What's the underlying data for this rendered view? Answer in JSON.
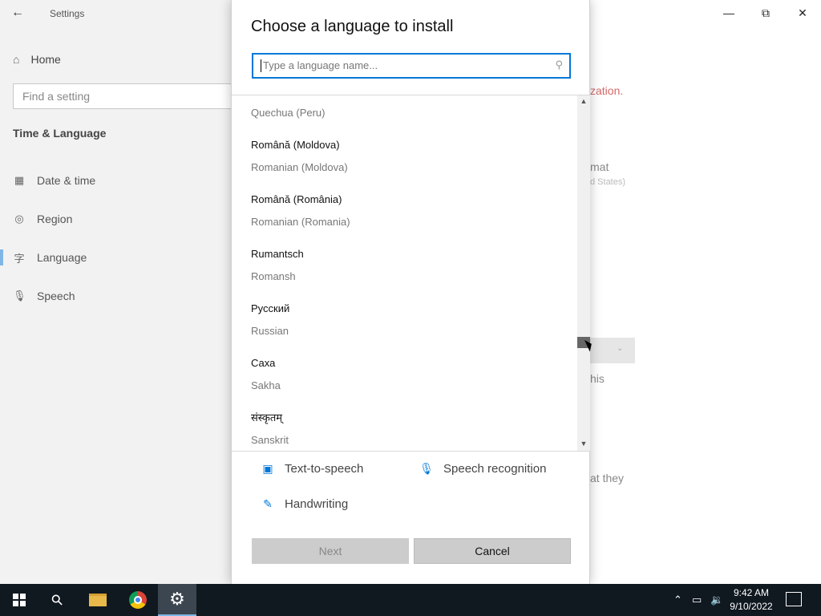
{
  "settings": {
    "title": "Settings",
    "home_label": "Home",
    "search_placeholder": "Find a setting",
    "section_title": "Time & Language",
    "nav_items": [
      {
        "label": "Date & time",
        "icon": "calendar-clock-icon"
      },
      {
        "label": "Region",
        "icon": "globe-icon"
      },
      {
        "label": "Language",
        "icon": "language-icon"
      },
      {
        "label": "Speech",
        "icon": "microphone-icon"
      }
    ],
    "active_nav": "Language",
    "partial_texts": {
      "localization": "zation.",
      "format": "mat",
      "united_states": "d States)",
      "this": "his",
      "that_they": "at they"
    },
    "window_controls": [
      "minimize",
      "restore",
      "close"
    ]
  },
  "dialog": {
    "title": "Choose a language to install",
    "search_placeholder": "Type a language name...",
    "languages": [
      {
        "native": "",
        "english": "Quechua (Peru)"
      },
      {
        "native": "Română (Moldova)",
        "english": "Romanian (Moldova)"
      },
      {
        "native": "Română (România)",
        "english": "Romanian (Romania)"
      },
      {
        "native": "Rumantsch",
        "english": "Romansh"
      },
      {
        "native": "Русский",
        "english": "Russian"
      },
      {
        "native": "Саха",
        "english": "Sakha"
      },
      {
        "native": "संस्कृतम्",
        "english": "Sanskrit"
      }
    ],
    "features": [
      {
        "label": "Text-to-speech",
        "icon": "text-to-speech-icon"
      },
      {
        "label": "Speech recognition",
        "icon": "microphone-icon"
      },
      {
        "label": "Handwriting",
        "icon": "handwriting-icon"
      }
    ],
    "buttons": {
      "next": "Next",
      "cancel": "Cancel"
    },
    "next_enabled": false
  },
  "taskbar": {
    "apps": [
      "start",
      "search",
      "file-explorer",
      "chrome",
      "settings"
    ],
    "active_app": "settings",
    "time": "9:42 AM",
    "date": "9/10/2022"
  },
  "colors": {
    "accent": "#0078d7",
    "taskbar": "#101820"
  }
}
